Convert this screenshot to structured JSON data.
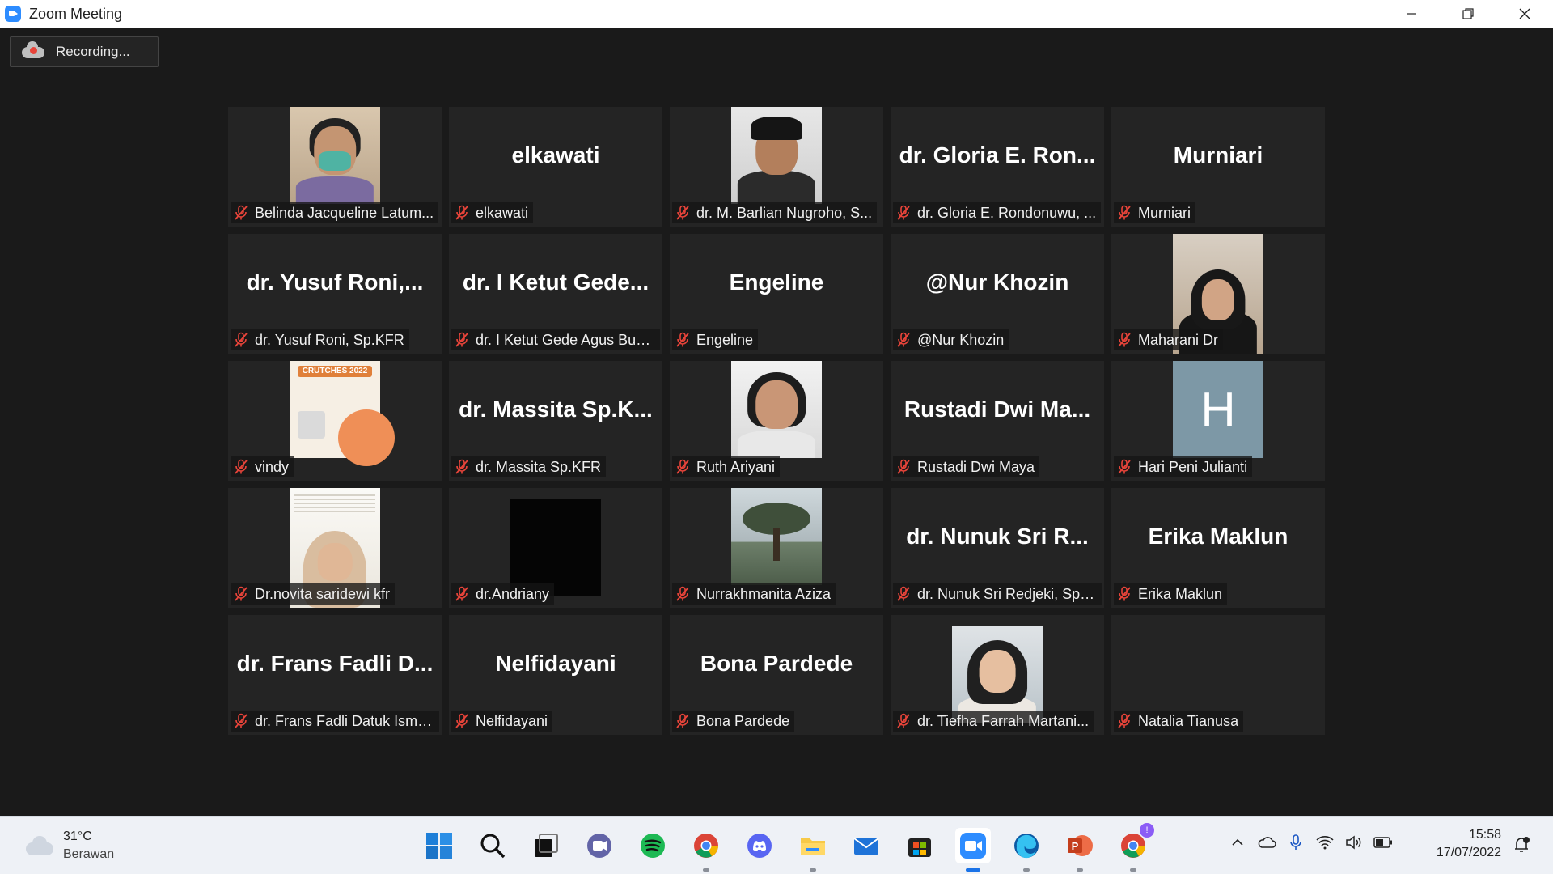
{
  "window": {
    "title": "Zoom Meeting"
  },
  "recording": {
    "label": "Recording..."
  },
  "participants": [
    {
      "big": "",
      "label": "Belinda Jacqueline Latum...",
      "video": "face-mask"
    },
    {
      "big": "elkawati",
      "label": "elkawati"
    },
    {
      "big": "",
      "label": "dr. M. Barlian Nugroho, S...",
      "video": "face-formal"
    },
    {
      "big": "dr. Gloria E. Ron...",
      "label": "dr. Gloria E. Rondonuwu, ..."
    },
    {
      "big": "Murniari",
      "label": "Murniari"
    },
    {
      "big": "dr. Yusuf Roni,...",
      "label": "dr. Yusuf Roni, Sp.KFR"
    },
    {
      "big": "dr. I Ketut Gede...",
      "label": "dr. I Ketut Gede Agus Bud..."
    },
    {
      "big": "Engeline",
      "label": "Engeline"
    },
    {
      "big": "@Nur Khozin",
      "label": "@Nur Khozin"
    },
    {
      "big": "",
      "label": "Maharani Dr",
      "video": "face-hijab-tall"
    },
    {
      "big": "",
      "label": "vindy",
      "video": "poster",
      "poster_title": "CRUTCHES 2022"
    },
    {
      "big": "dr. Massita Sp.K...",
      "label": "dr. Massita Sp.KFR"
    },
    {
      "big": "",
      "label": "Ruth Ariyani",
      "video": "face-glasses"
    },
    {
      "big": "Rustadi Dwi Ma...",
      "label": "Rustadi Dwi Maya"
    },
    {
      "big": "",
      "label": "Hari Peni Julianti",
      "video": "initial",
      "initial": "H"
    },
    {
      "big": "",
      "label": "Dr.novita saridewi kfr",
      "video": "face-hijab-full"
    },
    {
      "big": "",
      "label": "dr.Andriany",
      "video": "black"
    },
    {
      "big": "",
      "label": "Nurrakhmanita Aziza",
      "video": "tree"
    },
    {
      "big": "dr. Nunuk Sri R...",
      "label": "dr. Nunuk Sri Redjeki, Sp. ..."
    },
    {
      "big": "Erika Maklun",
      "label": "Erika Maklun"
    },
    {
      "big": "dr. Frans Fadli D...",
      "label": "dr. Frans Fadli Datuk Isma..."
    },
    {
      "big": "Nelfidayani",
      "label": "Nelfidayani"
    },
    {
      "big": "Bona Pardede",
      "label": "Bona Pardede"
    },
    {
      "big": "",
      "label": "dr. Tiefha Farrah Martani...",
      "video": "face-hijab"
    },
    {
      "big": "",
      "label": "Natalia Tianusa"
    }
  ],
  "taskbar": {
    "weather": {
      "temp": "31°C",
      "condition": "Berawan"
    },
    "apps": [
      {
        "name": "windows-start-icon"
      },
      {
        "name": "search-icon"
      },
      {
        "name": "task-view-icon"
      },
      {
        "name": "chat-icon"
      },
      {
        "name": "spotify-icon"
      },
      {
        "name": "chrome-icon"
      },
      {
        "name": "discord-icon"
      },
      {
        "name": "file-explorer-icon"
      },
      {
        "name": "mail-icon"
      },
      {
        "name": "store-icon"
      },
      {
        "name": "zoom-icon",
        "active": true
      },
      {
        "name": "edge-icon"
      },
      {
        "name": "powerpoint-icon"
      },
      {
        "name": "chrome-profile-icon",
        "badge": "!"
      }
    ],
    "clock": {
      "time": "15:58",
      "date": "17/07/2022"
    }
  },
  "colors": {
    "mute_red": "#e8443a",
    "tile_bg": "#242424",
    "page_bg": "#1a1a1a"
  }
}
